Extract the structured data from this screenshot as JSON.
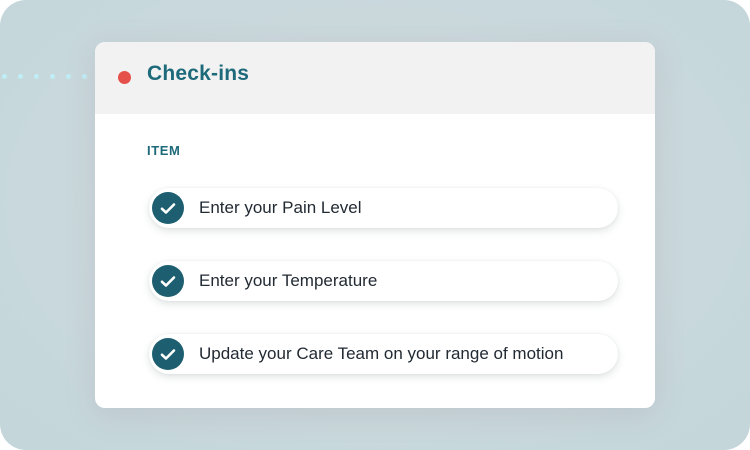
{
  "card": {
    "title": "Check-ins",
    "section_label": "ITEM",
    "items": [
      {
        "label": "Enter your Pain Level",
        "checked": true
      },
      {
        "label": "Enter your Temperature",
        "checked": true
      },
      {
        "label": "Update your Care Team on your range of motion",
        "checked": true
      }
    ]
  },
  "icons": {
    "status": "status-dot-icon",
    "check": "checkmark-icon"
  },
  "colors": {
    "accent": "#1d6a7a",
    "check_fill": "#1d5f70",
    "status_dot": "#e5514a",
    "dotted_line": "#bfeef6",
    "header_bg": "#f2f2f2"
  }
}
